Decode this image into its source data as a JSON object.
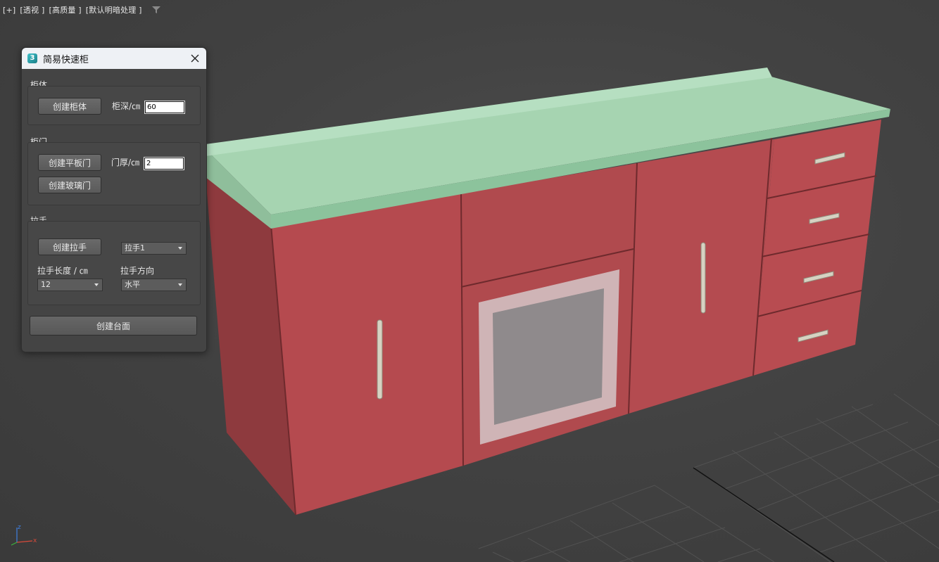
{
  "viewport": {
    "labels": [
      "[+]",
      "[透视 ]",
      "[高质量 ]",
      "[默认明暗处理 ]"
    ],
    "filter_icon": "filter-icon"
  },
  "panel": {
    "title": "简易快速柜",
    "app_icon_text": "3",
    "close_icon": "close-icon",
    "cabinet": {
      "group_label": "柜体",
      "create_button": "创建柜体",
      "depth_label": "柜深/㎝",
      "depth_value": "60"
    },
    "door": {
      "group_label": "柜门",
      "flat_door_button": "创建平板门",
      "glass_door_button": "创建玻璃门",
      "thickness_label": "门厚/㎝",
      "thickness_value": "2"
    },
    "handle": {
      "group_label": "拉手",
      "create_button": "创建拉手",
      "type_selected": "拉手1",
      "length_label": "拉手长度 / ㎝",
      "length_selected": "12",
      "direction_label": "拉手方向",
      "direction_selected": "水平"
    },
    "create_top_button": "创建台面"
  },
  "colors": {
    "cabinet_red": "#b54a4f",
    "countertop_green": "#a6d4b1",
    "handle_silver": "#d6d2c2",
    "viewport_bg": "#444444"
  },
  "gizmo": {
    "z": "z",
    "x": "x"
  }
}
